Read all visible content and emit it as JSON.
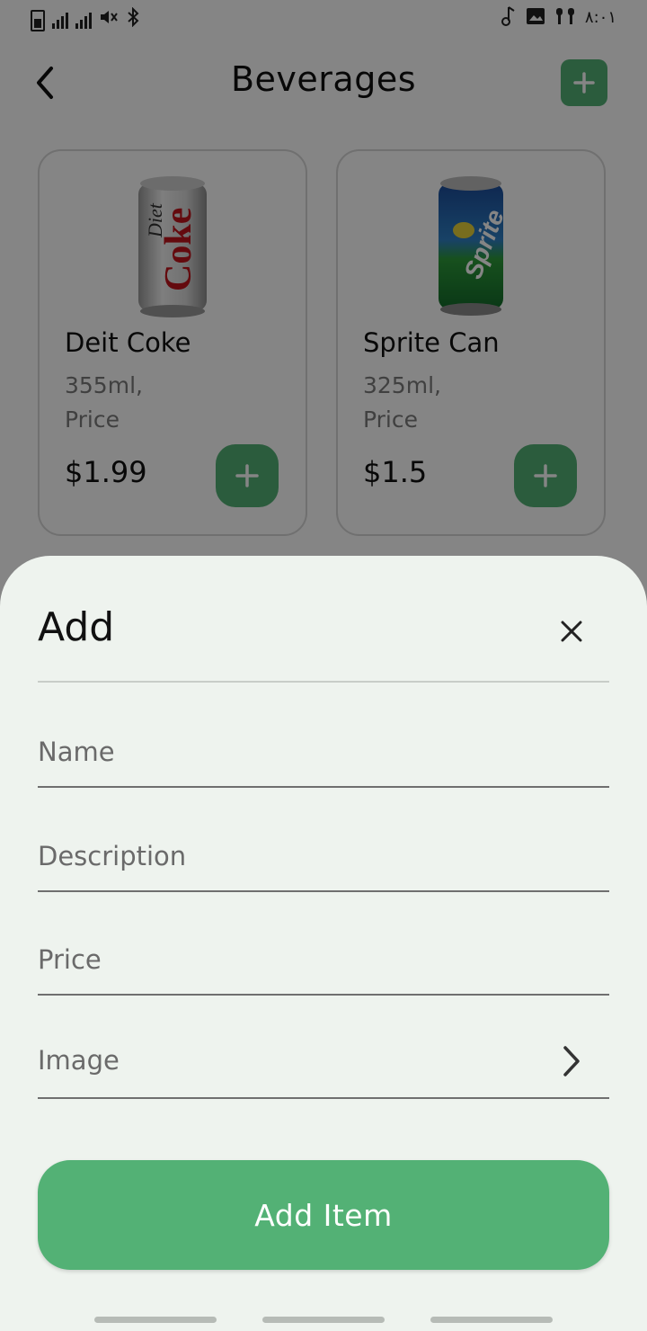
{
  "colors": {
    "accent": "#53b175",
    "sheet_bg": "#eef3ee",
    "scrim": "rgba(0,0,0,0.48)"
  },
  "status_bar": {
    "time": "٨:٠١",
    "icons": [
      "battery-icon",
      "signal-icon",
      "signal-icon",
      "mute-icon",
      "bluetooth-icon",
      "music-note-icon",
      "gallery-icon",
      "earbuds-icon"
    ]
  },
  "header": {
    "title": "Beverages",
    "back_icon": "chevron-left-icon",
    "add_icon": "plus-icon"
  },
  "products": [
    {
      "name": "Deit Coke",
      "size": "355ml,",
      "price_label": "Price",
      "price": "$1.99",
      "image": "diet-coke-can"
    },
    {
      "name": "Sprite Can",
      "size": "325ml,",
      "price_label": "Price",
      "price": "$1.5",
      "image": "sprite-can"
    }
  ],
  "sheet": {
    "title": "Add",
    "close_icon": "close-icon",
    "fields": {
      "name_placeholder": "Name",
      "description_placeholder": "Description",
      "price_placeholder": "Price",
      "image_label": "Image"
    },
    "submit_label": "Add Item"
  }
}
